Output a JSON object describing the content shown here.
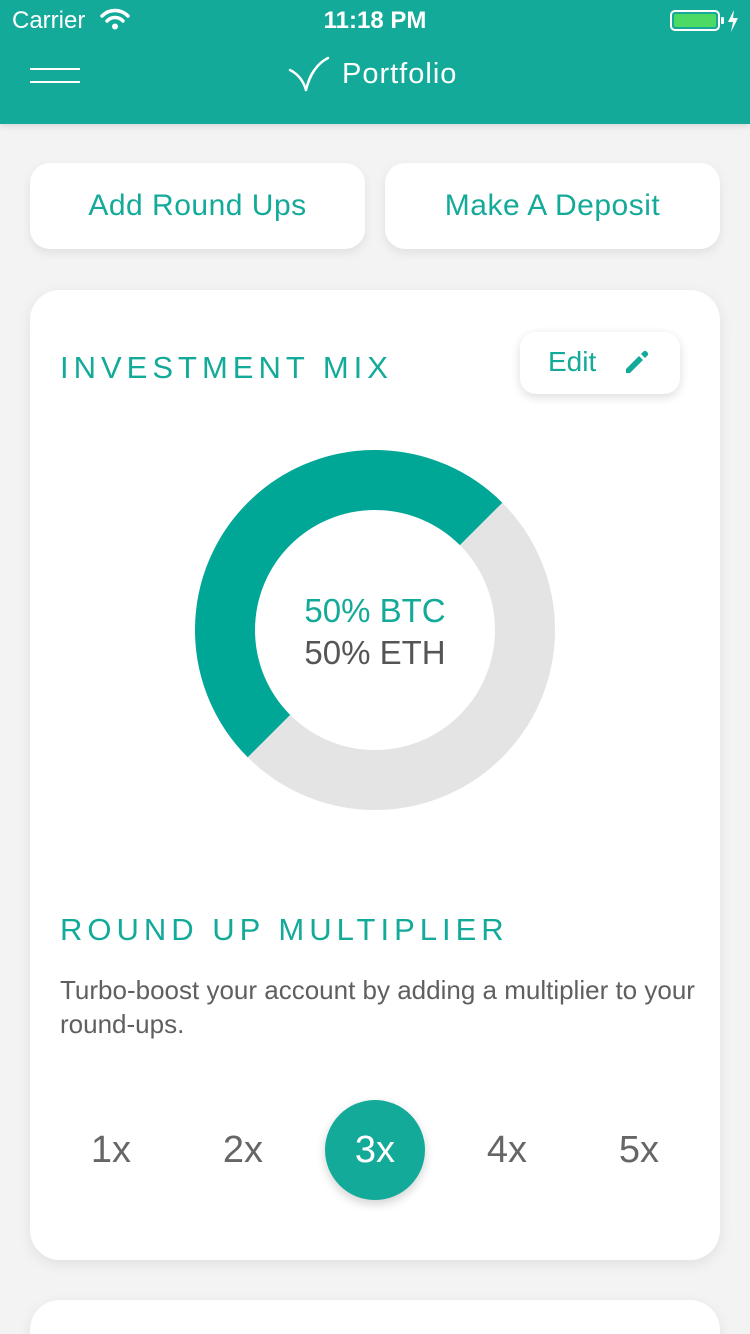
{
  "status_bar": {
    "carrier": "Carrier",
    "time": "11:18 PM",
    "wifi_icon": "wifi-icon",
    "battery_icon": "battery-charging-icon"
  },
  "nav": {
    "title": "Portfolio",
    "menu_icon": "hamburger-menu-icon",
    "logo_icon": "leaf-logo-icon"
  },
  "actions": {
    "round_ups_label": "Add Round Ups",
    "deposit_label": "Make A Deposit"
  },
  "investment_mix": {
    "title": "INVESTMENT MIX",
    "edit_label": "Edit",
    "edit_icon": "pencil-icon",
    "btc_text": "50% BTC",
    "eth_text": "50% ETH",
    "btc_fraction": 0.5,
    "eth_fraction": 0.5
  },
  "multiplier": {
    "title": "ROUND UP MULTIPLIER",
    "description": "Turbo-boost your account by adding a multiplier to your round-ups.",
    "options": [
      "1x",
      "2x",
      "3x",
      "4x",
      "5x"
    ],
    "selected": "3x"
  },
  "colors": {
    "accent": "#14aa99",
    "ring_background": "#e4e4e4",
    "page_background": "#f3f3f3"
  }
}
